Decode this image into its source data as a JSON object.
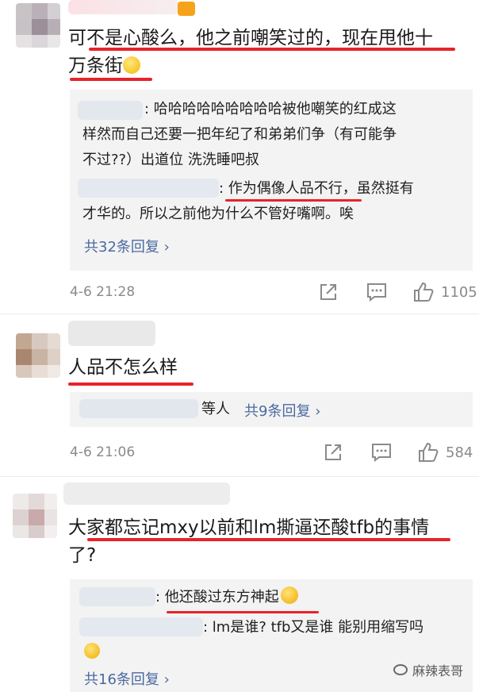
{
  "comment1": {
    "text_line1": "可不是心酸么，他之前嘲笑过的，现在甩他十",
    "text_line2": "万条街",
    "emoji": "smile-emoji",
    "replies": [
      {
        "line1": ": 哈哈哈哈哈哈哈哈哈被他嘲笑的红成这",
        "line2": "样然而自己还要一把年纪了和弟弟们争（有可能争",
        "line3": "不过??）出道位 洗洗睡吧叔"
      },
      {
        "line1_a": ": ",
        "line1_b": "作为偶像人品不行",
        "line1_c": "，虽然挺有",
        "line2": "才华的。所以之前他为什么不管好嘴啊。唉"
      }
    ],
    "more": "共32条回复",
    "time": "4-6 21:28",
    "likes": "1105"
  },
  "comment2": {
    "text": "人品不怎么样",
    "reply_suffix": "等人",
    "more": "共9条回复",
    "time": "4-6 21:06",
    "likes": "584"
  },
  "comment3": {
    "text_line1": "大家都忘记mxy以前和lm撕逼还酸tfb的事情",
    "text_line2": "了?",
    "replies": [
      {
        "prefix": ": ",
        "text": "他还酸过东方神起"
      },
      {
        "line1": ": lm是谁? tfb又是谁  能别用缩写吗"
      }
    ],
    "more": "共16条回复"
  },
  "watermark": "麻辣表哥",
  "colors": {
    "underline": "#e8232a",
    "link": "#4b6aa0",
    "meta": "#8a8a8a"
  }
}
